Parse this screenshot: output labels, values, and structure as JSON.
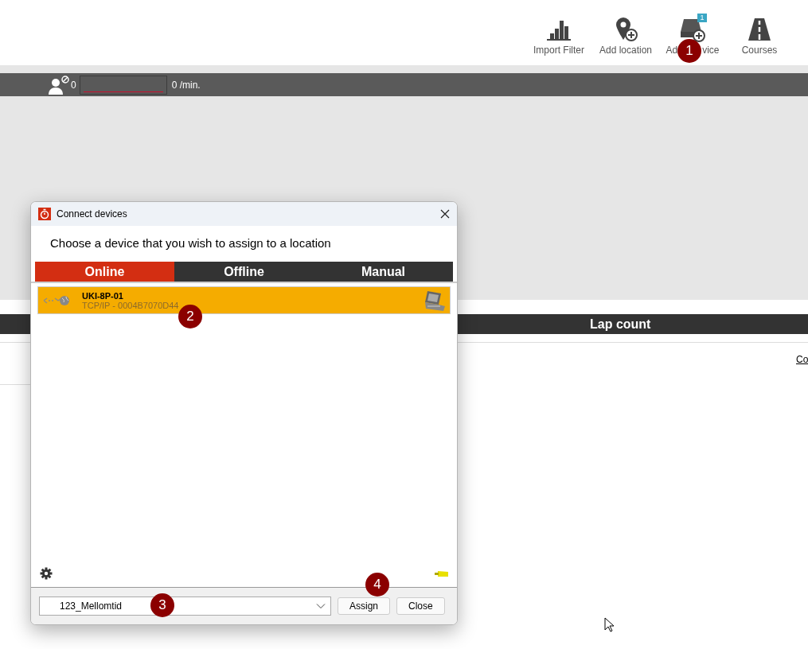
{
  "toolbar": {
    "items": [
      {
        "label": "Import Filter",
        "kind": "chart"
      },
      {
        "label": "Add location",
        "kind": "location"
      },
      {
        "label_parts": [
          "Ad",
          "vice"
        ],
        "kind": "device",
        "badge": "1"
      },
      {
        "label": "Courses",
        "kind": "road"
      }
    ]
  },
  "status_bar": {
    "count": "0",
    "rate": "0 /min."
  },
  "panel": {
    "header": "Lap count",
    "link": "Co"
  },
  "dialog": {
    "title": "Connect devices",
    "instruction": "Choose a device that you wish to assign to a location",
    "tabs": [
      {
        "label": "Online",
        "selected": true
      },
      {
        "label": "Offline",
        "selected": false
      },
      {
        "label": "Manual",
        "selected": false
      }
    ],
    "devices": [
      {
        "name": "UKI-8P-01",
        "address": "TCP/IP - 0004B7070D44",
        "selected": true
      }
    ],
    "location": "123_Mellomtid",
    "buttons": [
      "Assign",
      "Close"
    ]
  },
  "callouts": [
    "1",
    "2",
    "3",
    "4"
  ]
}
